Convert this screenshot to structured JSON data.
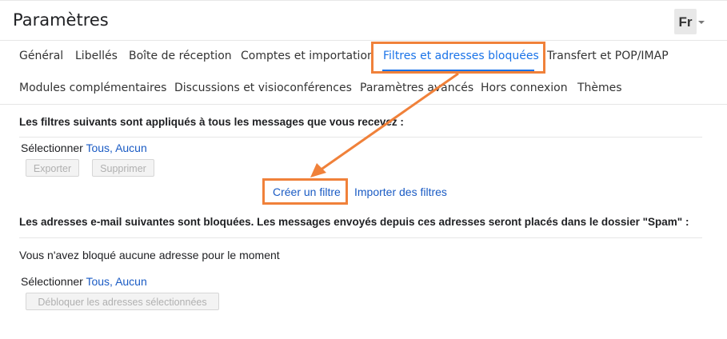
{
  "page": {
    "title": "Paramètres",
    "account_initial": "Fr"
  },
  "tabs": [
    {
      "label": "Général"
    },
    {
      "label": "Libellés"
    },
    {
      "label": "Boîte de réception"
    },
    {
      "label": "Comptes et importation"
    },
    {
      "label": "Filtres et adresses bloquées",
      "active": true
    },
    {
      "label": "Transfert et POP/IMAP"
    },
    {
      "label": "Modules complémentaires"
    },
    {
      "label": "Discussions et visioconférences"
    },
    {
      "label": "Paramètres avancés"
    },
    {
      "label": "Hors connexion"
    },
    {
      "label": "Thèmes"
    }
  ],
  "filters": {
    "heading": "Les filtres suivants sont appliqués à tous les messages que vous recevez :",
    "select_label": "Sélectionner",
    "select_all": "Tous",
    "select_sep": ",",
    "select_none": "Aucun",
    "export_button": "Exporter",
    "delete_button": "Supprimer",
    "create_filter": "Créer un filtre",
    "import_filters": "Importer des filtres"
  },
  "blocked": {
    "heading": "Les adresses e-mail suivantes sont bloquées. Les messages envoyés depuis ces adresses seront placés dans le dossier \"Spam\" :",
    "empty_text": "Vous n'avez bloqué aucune adresse pour le moment",
    "select_label": "Sélectionner",
    "select_all": "Tous",
    "select_sep": ",",
    "select_none": "Aucun",
    "unblock_button": "Débloquer les adresses sélectionnées"
  },
  "colors": {
    "highlight": "#f0813a",
    "active_tab": "#1a73e8",
    "link": "#1a5bc4"
  }
}
